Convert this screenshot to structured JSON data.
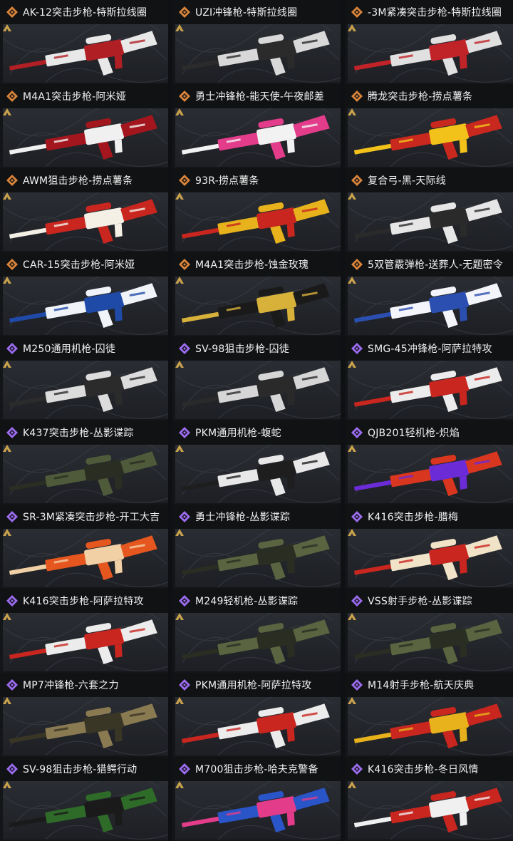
{
  "colors": {
    "gold_rarity": "#d9843a",
    "purple_rarity": "#9b6cf0",
    "card_bg": "#141519",
    "thumb_bg": "#23262b",
    "corner_mark": "#c9a24b"
  },
  "items": [
    {
      "title": "AK-12突击步枪-特斯拉线圈",
      "rarity": "gold",
      "icon": "rarity-diamond-icon",
      "colors": [
        "#e8e8e8",
        "#b01f24"
      ]
    },
    {
      "title": "UZI冲锋枪-特斯拉线圈",
      "rarity": "gold",
      "icon": "rarity-diamond-icon",
      "colors": [
        "#d8d8d8",
        "#2b2b2b"
      ]
    },
    {
      "title": "-3M紧凑突击步枪-特斯拉线圈",
      "rarity": "gold",
      "icon": "rarity-diamond-icon",
      "colors": [
        "#e0e0e0",
        "#c02328"
      ]
    },
    {
      "title": "M4A1突击步枪-阿米娅",
      "rarity": "gold",
      "icon": "rarity-diamond-icon",
      "colors": [
        "#a3161d",
        "#f0f0f0"
      ]
    },
    {
      "title": "勇士冲锋枪-能天使-午夜邮差",
      "rarity": "gold",
      "icon": "rarity-diamond-icon",
      "colors": [
        "#e23c8a",
        "#f2f2f2"
      ]
    },
    {
      "title": "腾龙突击步枪-捞点薯条",
      "rarity": "gold",
      "icon": "rarity-diamond-icon",
      "colors": [
        "#c9281f",
        "#f2c21b"
      ]
    },
    {
      "title": "AWM狙击步枪-捞点薯条",
      "rarity": "gold",
      "icon": "rarity-diamond-icon",
      "colors": [
        "#c8261f",
        "#f4f0e6"
      ]
    },
    {
      "title": "93R-捞点薯条",
      "rarity": "gold",
      "icon": "rarity-diamond-icon",
      "colors": [
        "#e7b21c",
        "#c8261f"
      ]
    },
    {
      "title": "复合弓-黑-天际线",
      "rarity": "gold",
      "icon": "rarity-diamond-icon",
      "colors": [
        "#e6e6e6",
        "#2a2a2a"
      ]
    },
    {
      "title": "CAR-15突击步枪-阿米娅",
      "rarity": "gold",
      "icon": "rarity-diamond-icon",
      "colors": [
        "#f0f3f8",
        "#1f4aa8"
      ]
    },
    {
      "title": "M4A1突击步枪-蚀金玫瑰",
      "rarity": "gold",
      "icon": "rarity-diamond-icon",
      "colors": [
        "#1a1a1a",
        "#d7b13a"
      ]
    },
    {
      "title": "5双管霰弹枪-送葬人-无题密令",
      "rarity": "gold",
      "icon": "rarity-diamond-icon",
      "colors": [
        "#f3f5fa",
        "#2b4fb0"
      ]
    },
    {
      "title": "M250通用机枪-囚徒",
      "rarity": "purple",
      "icon": "rarity-diamond-icon",
      "colors": [
        "#dcdcdc",
        "#2b2b2b"
      ]
    },
    {
      "title": "SV-98狙击步枪-囚徒",
      "rarity": "purple",
      "icon": "rarity-diamond-icon",
      "colors": [
        "#d6d6d6",
        "#2a2a2a"
      ]
    },
    {
      "title": "SMG-45冲锋枪-阿萨拉特攻",
      "rarity": "purple",
      "icon": "rarity-diamond-icon",
      "colors": [
        "#ececec",
        "#c8261f"
      ]
    },
    {
      "title": "K437突击步枪-丛影谍踪",
      "rarity": "purple",
      "icon": "rarity-diamond-icon",
      "colors": [
        "#4f5a3a",
        "#2a2d22"
      ]
    },
    {
      "title": "PKM通用机枪-蝮蛇",
      "rarity": "purple",
      "icon": "rarity-diamond-icon",
      "colors": [
        "#e8e8e8",
        "#1e1e1e"
      ]
    },
    {
      "title": "QJB201轻机枪-炽焰",
      "rarity": "purple",
      "icon": "rarity-diamond-icon",
      "colors": [
        "#d9361f",
        "#6b2bd6"
      ]
    },
    {
      "title": "SR-3M紧凑突击步枪-开工大吉",
      "rarity": "purple",
      "icon": "rarity-diamond-icon",
      "colors": [
        "#e6561f",
        "#f2d0a6"
      ]
    },
    {
      "title": "勇士冲锋枪-丛影谍踪",
      "rarity": "purple",
      "icon": "rarity-diamond-icon",
      "colors": [
        "#5a6440",
        "#2a2d22"
      ]
    },
    {
      "title": "K416突击步枪-腊梅",
      "rarity": "purple",
      "icon": "rarity-diamond-icon",
      "colors": [
        "#f1e3c8",
        "#c9261f"
      ]
    },
    {
      "title": "K416突击步枪-阿萨拉特攻",
      "rarity": "purple",
      "icon": "rarity-diamond-icon",
      "colors": [
        "#ececec",
        "#c8261f"
      ]
    },
    {
      "title": "M249轻机枪-丛影谍踪",
      "rarity": "purple",
      "icon": "rarity-diamond-icon",
      "colors": [
        "#5a6440",
        "#2a2d22"
      ]
    },
    {
      "title": "VSS射手步枪-丛影谍踪",
      "rarity": "purple",
      "icon": "rarity-diamond-icon",
      "colors": [
        "#5a6440",
        "#2a2d22"
      ]
    },
    {
      "title": "MP7冲锋枪-六套之力",
      "rarity": "purple",
      "icon": "rarity-diamond-icon",
      "colors": [
        "#8a7a52",
        "#3a3626"
      ]
    },
    {
      "title": "PKM通用机枪-阿萨拉特攻",
      "rarity": "purple",
      "icon": "rarity-diamond-icon",
      "colors": [
        "#ececec",
        "#c8261f"
      ]
    },
    {
      "title": "M14射手步枪-航天庆典",
      "rarity": "purple",
      "icon": "rarity-diamond-icon",
      "colors": [
        "#c8261f",
        "#e8b21c"
      ]
    },
    {
      "title": "SV-98狙击步枪-猎鳄行动",
      "rarity": "purple",
      "icon": "rarity-diamond-icon",
      "colors": [
        "#2f6b28",
        "#1a1a1a"
      ]
    },
    {
      "title": "M700狙击步枪-哈夫克警备",
      "rarity": "purple",
      "icon": "rarity-diamond-icon",
      "colors": [
        "#2a55c9",
        "#e23c8a"
      ]
    },
    {
      "title": "K416突击步枪-冬日风情",
      "rarity": "purple",
      "icon": "rarity-diamond-icon",
      "colors": [
        "#c8261f",
        "#f0f0f0"
      ]
    }
  ]
}
